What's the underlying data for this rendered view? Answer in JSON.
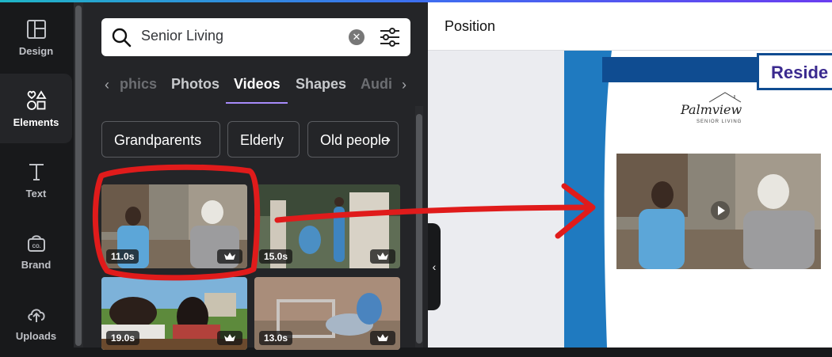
{
  "sidebar": {
    "items": [
      {
        "label": "Design",
        "icon": "layout-icon"
      },
      {
        "label": "Elements",
        "icon": "shapes-icon"
      },
      {
        "label": "Text",
        "icon": "text-icon"
      },
      {
        "label": "Brand",
        "icon": "brand-icon"
      },
      {
        "label": "Uploads",
        "icon": "cloud-upload-icon"
      }
    ],
    "active_index": 1
  },
  "search": {
    "query": "Senior Living",
    "clear_icon": "clear-icon",
    "filter_icon": "filter-icon"
  },
  "tabs": {
    "items": [
      "phics",
      "Photos",
      "Videos",
      "Shapes",
      "Audi"
    ],
    "active": "Videos"
  },
  "chips": [
    "Grandparents",
    "Elderly",
    "Old people"
  ],
  "videos": [
    {
      "duration": "11.0s",
      "premium": true
    },
    {
      "duration": "15.0s",
      "premium": true
    },
    {
      "duration": "19.0s",
      "premium": true
    },
    {
      "duration": "13.0s",
      "premium": true
    }
  ],
  "editor": {
    "toolbar_label": "Position",
    "design": {
      "heading": "Reside",
      "logo_name": "Palmview",
      "logo_tagline": "SENIOR LIVING"
    }
  },
  "colors": {
    "accent": "#a78bfa",
    "brand_blue": "#0f4c91",
    "annotation": "#e01b1b"
  }
}
